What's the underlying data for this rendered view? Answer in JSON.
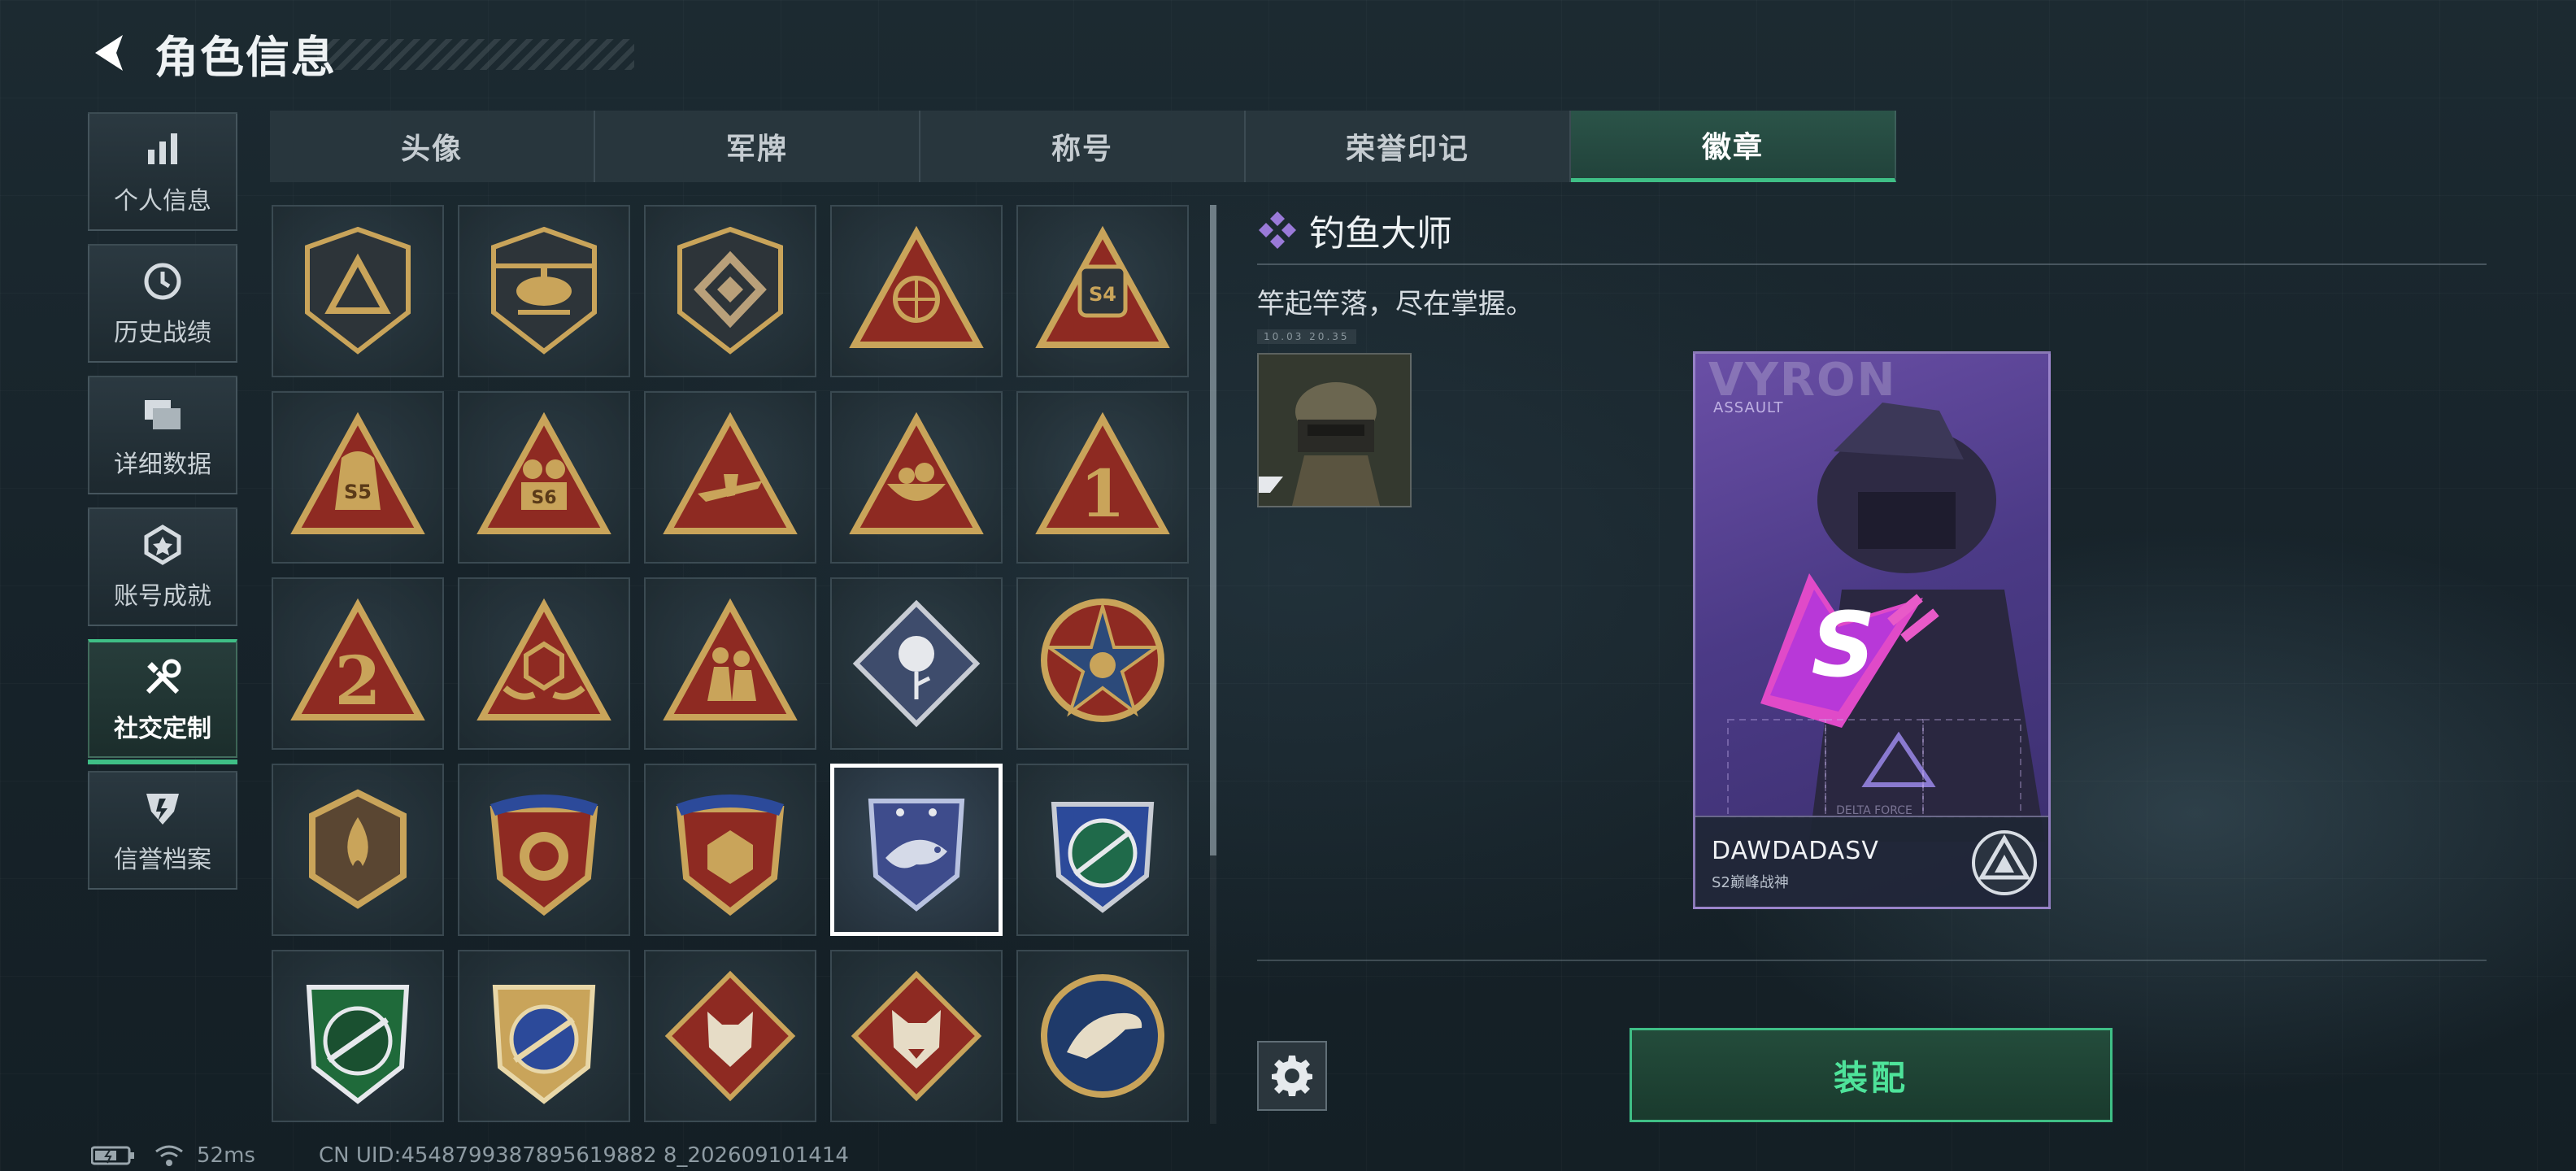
{
  "header": {
    "title": "角色信息"
  },
  "sidebar": {
    "items": [
      {
        "label": "个人信息",
        "icon": "bar-chart-icon"
      },
      {
        "label": "历史战绩",
        "icon": "history-clock-icon"
      },
      {
        "label": "详细数据",
        "icon": "folders-icon"
      },
      {
        "label": "账号成就",
        "icon": "achievement-badge-icon"
      },
      {
        "label": "社交定制",
        "icon": "tools-icon",
        "active": true
      },
      {
        "label": "信誉档案",
        "icon": "credit-shield-icon"
      }
    ]
  },
  "tabs": [
    {
      "label": "头像"
    },
    {
      "label": "军牌"
    },
    {
      "label": "称号"
    },
    {
      "label": "荣誉印记"
    },
    {
      "label": "徽章",
      "active": true
    }
  ],
  "badges": {
    "rows": 5,
    "cols": 5,
    "selected_index": 18,
    "visible_labels": [
      "S4",
      "S5",
      "S6",
      "1",
      "2"
    ]
  },
  "detail": {
    "badge_name": "钓鱼大师",
    "badge_desc": "竿起竿落，尽在掌握。",
    "tiny_meta": "10.03  20.35",
    "card": {
      "name_watermark": "VYRON",
      "class": "ASSAULT",
      "player_name": "DAWDADASV",
      "rank_text": "S2巅峰战神",
      "center_logo": "S",
      "bottom_tag": "DELTA FORCE"
    },
    "equip_label": "装配"
  },
  "status_bar": {
    "ping": "52ms",
    "uid": "CN UID:4548799387895619882 8_202609101414"
  },
  "colors": {
    "accent": "#3fbf86",
    "card_purple": "#5a43a0",
    "gold": "#c9a45a",
    "red": "#8e2a22"
  }
}
